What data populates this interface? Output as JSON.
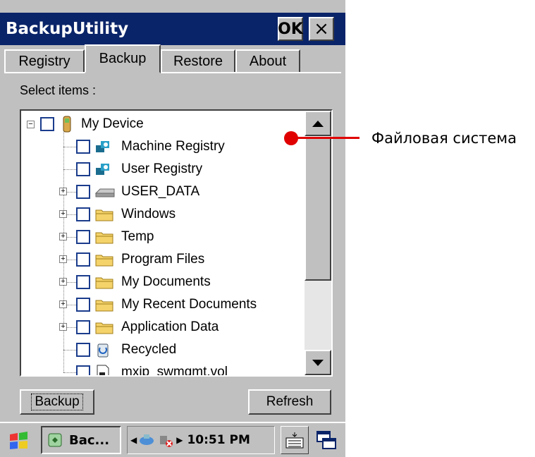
{
  "window": {
    "title": "BackupUtility",
    "ok_label": "OK",
    "close_label": "×"
  },
  "tabs": [
    {
      "label": "Registry",
      "selected": false
    },
    {
      "label": "Backup",
      "selected": true
    },
    {
      "label": "Restore",
      "selected": false
    },
    {
      "label": "About",
      "selected": false
    }
  ],
  "select_label": "Select items :",
  "tree": {
    "root": {
      "label": "My Device",
      "expander": "−",
      "checked": false,
      "icon": "device-icon"
    },
    "items": [
      {
        "label": "Machine Registry",
        "expander": "",
        "checked": false,
        "icon": "registry-icon"
      },
      {
        "label": "User Registry",
        "expander": "",
        "checked": false,
        "icon": "registry-icon"
      },
      {
        "label": "USER_DATA",
        "expander": "+",
        "checked": false,
        "icon": "drive-icon"
      },
      {
        "label": "Windows",
        "expander": "+",
        "checked": false,
        "icon": "folder-icon"
      },
      {
        "label": "Temp",
        "expander": "+",
        "checked": false,
        "icon": "folder-icon"
      },
      {
        "label": "Program Files",
        "expander": "+",
        "checked": false,
        "icon": "folder-icon"
      },
      {
        "label": "My Documents",
        "expander": "+",
        "checked": false,
        "icon": "folder-icon"
      },
      {
        "label": "My Recent Documents",
        "expander": "+",
        "checked": false,
        "icon": "folder-icon"
      },
      {
        "label": "Application Data",
        "expander": "+",
        "checked": false,
        "icon": "folder-icon"
      },
      {
        "label": "Recycled",
        "expander": "",
        "checked": false,
        "icon": "recycle-bin-icon"
      },
      {
        "label": "mxip_swmgmt.vol",
        "expander": "",
        "checked": false,
        "icon": "file-icon"
      }
    ]
  },
  "buttons": {
    "backup": "Backup",
    "refresh": "Refresh"
  },
  "taskbar": {
    "task_label": "Bac...",
    "time": "10:51 PM"
  },
  "callout": {
    "label": "Файловая система",
    "color": "#e00000"
  },
  "colors": {
    "titlebar": "#0a2469",
    "face": "#c0c0c0",
    "checkbox_border": "#1a3c8c",
    "folder": "#f5d36b"
  }
}
